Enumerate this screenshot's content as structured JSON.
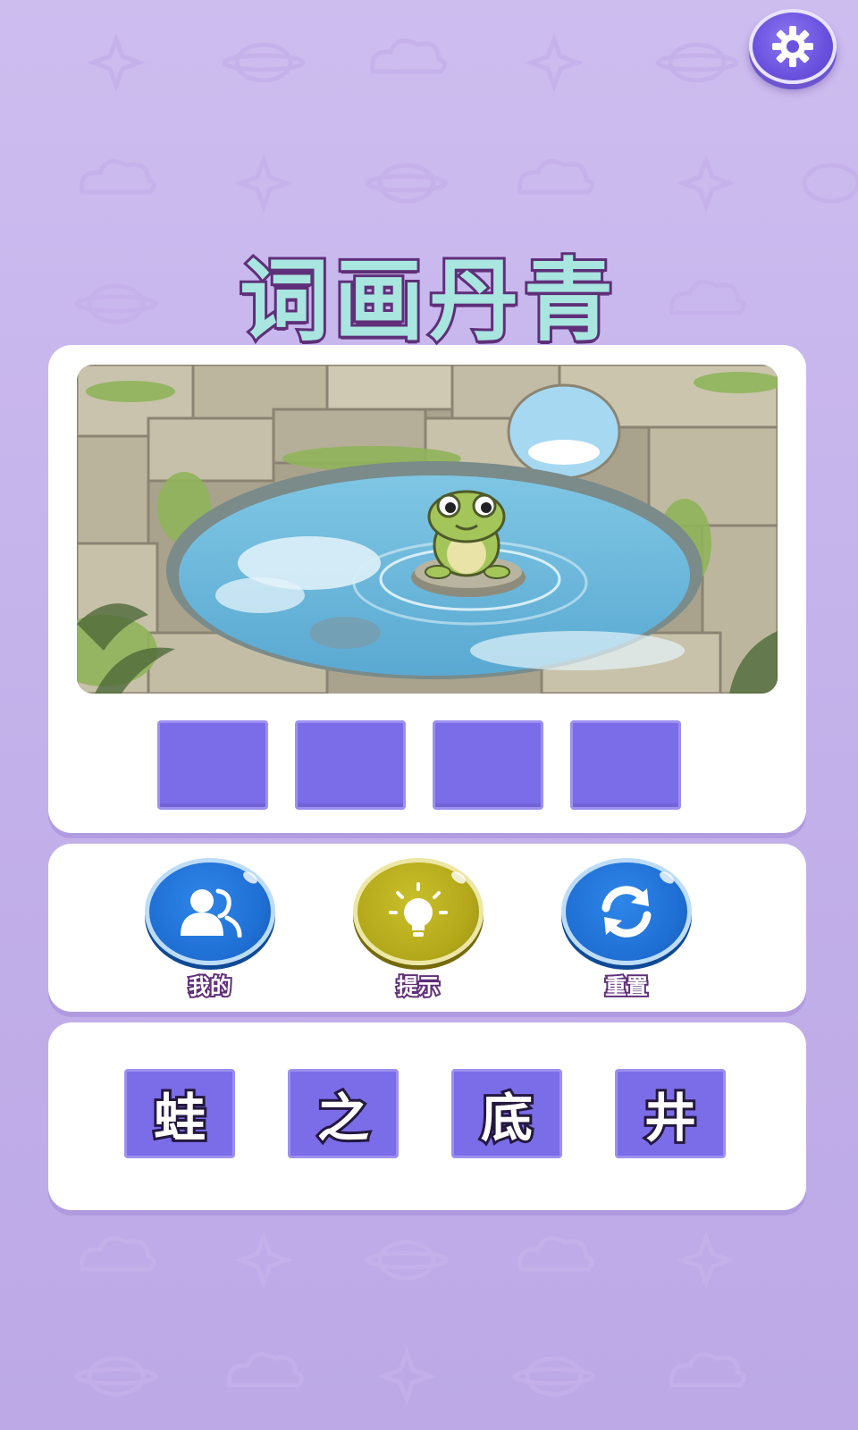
{
  "game": {
    "title": "词画丹青"
  },
  "settings": {
    "icon": "gear-icon"
  },
  "puzzle": {
    "image_subject": "frog-in-well",
    "answer_slots": [
      "",
      "",
      "",
      ""
    ]
  },
  "actions": [
    {
      "label": "我的",
      "icon": "users-icon",
      "color": "#1f74d8"
    },
    {
      "label": "提示",
      "icon": "lightbulb-icon",
      "color": "#b8ad1a"
    },
    {
      "label": "重置",
      "icon": "refresh-icon",
      "color": "#1f74d8"
    }
  ],
  "choices": [
    "蛙",
    "之",
    "底",
    "井"
  ],
  "colors": {
    "background": "#c8b8ee",
    "tile": "#7b6ce8",
    "title_fill": "#a8e6df",
    "title_stroke": "#5f2f79"
  }
}
